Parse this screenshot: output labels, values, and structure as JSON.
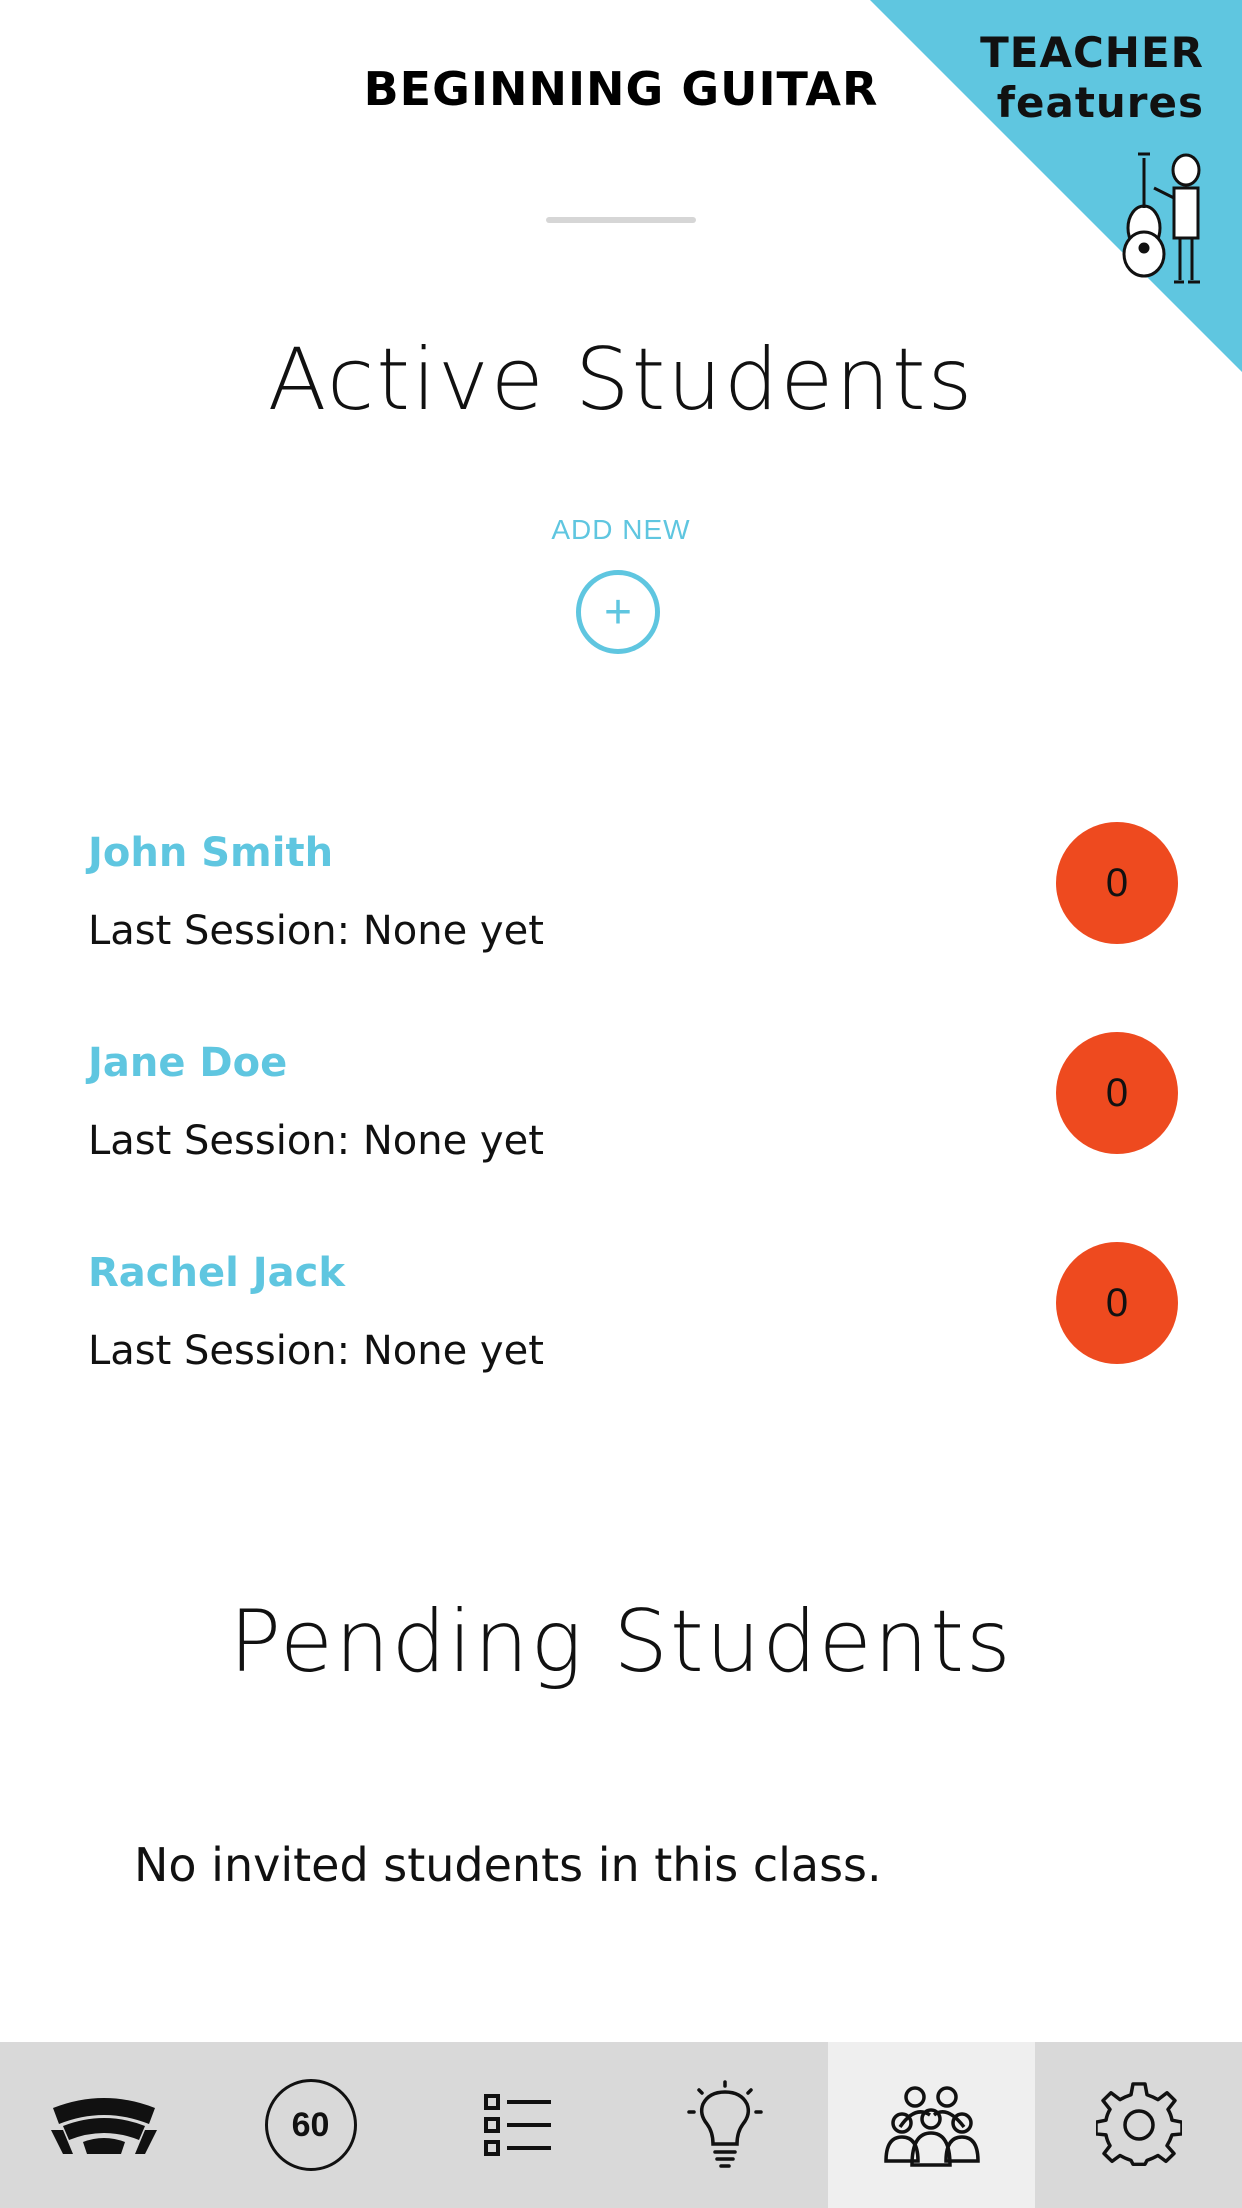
{
  "header": {
    "title": "BEGINNING GUITAR"
  },
  "teacher_badge": {
    "line1": "TEACHER",
    "line2": "features",
    "illustration": "teacher-with-cello-icon",
    "color": "#5fc6e0"
  },
  "active": {
    "title": "Active Students",
    "add_new_label": "ADD NEW",
    "add_icon": "+",
    "students": [
      {
        "name": "John Smith",
        "last_session": "Last Session: None yet",
        "count": "0"
      },
      {
        "name": "Jane Doe",
        "last_session": "Last Session: None yet",
        "count": "0"
      },
      {
        "name": "Rachel Jack",
        "last_session": "Last Session: None yet",
        "count": "0"
      }
    ]
  },
  "pending": {
    "title": "Pending Students",
    "empty_text": "No invited students in this class."
  },
  "tabbar": {
    "tabs": [
      {
        "icon": "app-logo-icon"
      },
      {
        "icon": "timer-icon",
        "label": "60"
      },
      {
        "icon": "list-icon"
      },
      {
        "icon": "lightbulb-icon"
      },
      {
        "icon": "students-group-icon",
        "active": true
      },
      {
        "icon": "gear-icon"
      }
    ]
  },
  "colors": {
    "accent": "#5fc6e0",
    "badge": "#ee4a1f",
    "tabbar": "#d9d9d9"
  }
}
